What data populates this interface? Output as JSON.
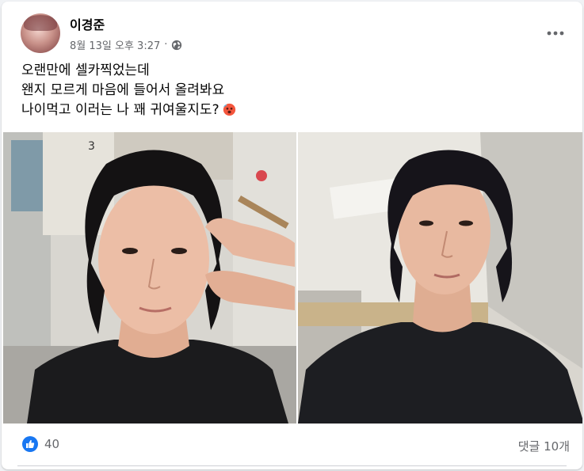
{
  "post": {
    "author": "이경준",
    "date": "8월 13일 오후 3:27",
    "meta_separator": "·",
    "privacy_icon": "globe-icon",
    "more_icon": "more-options-icon",
    "caption_lines": [
      "오랜만에 셀카찍었는데",
      "왠지 모르게 마음에 들어서 올려봐요",
      "나이먹고 이러는 나 꽤 귀여울지도?"
    ],
    "caption_emoji": "hot-face-emoji",
    "photos": [
      {
        "description_icon": "selfie-photo-left"
      },
      {
        "description_icon": "selfie-photo-right"
      }
    ],
    "reaction_icon": "like-icon",
    "reaction_count": "40",
    "comments_label": "댓글 10개",
    "colors": {
      "like_blue": "#1877f2",
      "secondary_text": "#65676b",
      "primary_text": "#050505"
    }
  }
}
